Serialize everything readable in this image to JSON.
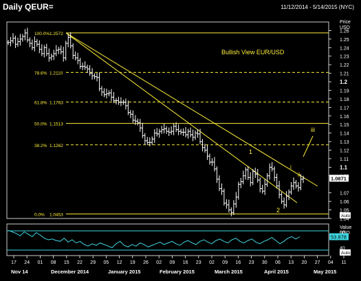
{
  "header": {
    "title": "Daily QEUR=",
    "date_range": "11/12/2014 - 5/14/2015 (NYC)"
  },
  "chart_data": [
    {
      "type": "candlestick",
      "instrument": "QEUR=",
      "title": "Bullish View EUR/USD",
      "y_axis_title": "Price",
      "y_axis_unit": "USD",
      "ylim": [
        1.04,
        1.27
      ],
      "yticks": [
        "1.26",
        "1.25",
        "1.24",
        "1.23",
        "1.22",
        "1.21",
        "1.2",
        "1.19",
        "1.18",
        "1.17",
        "1.16",
        "1.15",
        "1.14",
        "1.13",
        "1.12",
        "1.11",
        "1.1",
        "1.09",
        "1.07",
        "1.06",
        "1.05",
        "1.04"
      ],
      "last_price": "1.0871",
      "date_ticks": [
        "17",
        "24",
        "01",
        "08",
        "15",
        "22",
        "29",
        "05",
        "12",
        "19",
        "26",
        "02",
        "09",
        "16",
        "23",
        "02",
        "09",
        "16",
        "23",
        "30",
        "06",
        "13",
        "20",
        "27",
        "04",
        "11"
      ],
      "month_labels": [
        "Nov 14",
        "December 2014",
        "January 2015",
        "February 2015",
        "March 2015",
        "April 2015",
        "May 2015"
      ],
      "fibonacci_levels": [
        {
          "pct": "100.0%",
          "value": "1.2572",
          "style": "solid"
        },
        {
          "pct": "78.6%",
          "value": "1.2110",
          "style": "dashed"
        },
        {
          "pct": "61.8%",
          "value": "1.1763",
          "style": "dashed"
        },
        {
          "pct": "50.0%",
          "value": "1.1513",
          "style": "solid"
        },
        {
          "pct": "38.2%",
          "value": "1.1262",
          "style": "dashed"
        },
        {
          "pct": "0.0%",
          "value": "1.0453",
          "style": "solid"
        }
      ],
      "wave_labels": [
        "1",
        "2",
        "i",
        "ii",
        "iii"
      ],
      "closes": [
        1.246,
        1.248,
        1.251,
        1.244,
        1.247,
        1.25,
        1.253,
        1.2572,
        1.249,
        1.245,
        1.24,
        1.247,
        1.244,
        1.238,
        1.233,
        1.24,
        1.233,
        1.228,
        1.23,
        1.233,
        1.237,
        1.238,
        1.235,
        1.228,
        1.245,
        1.252,
        1.242,
        1.231,
        1.228,
        1.225,
        1.218,
        1.218,
        1.217,
        1.215,
        1.21,
        1.207,
        1.206,
        1.205,
        1.192,
        1.188,
        1.185,
        1.186,
        1.187,
        1.182,
        1.178,
        1.178,
        1.176,
        1.176,
        1.176,
        1.172,
        1.164,
        1.162,
        1.155,
        1.154,
        1.152,
        1.146,
        1.137,
        1.131,
        1.129,
        1.129,
        1.133,
        1.14,
        1.139,
        1.142,
        1.144,
        1.145,
        1.142,
        1.141,
        1.142,
        1.148,
        1.144,
        1.142,
        1.141,
        1.141,
        1.138,
        1.142,
        1.138,
        1.135,
        1.14,
        1.139,
        1.13,
        1.123,
        1.12,
        1.113,
        1.106,
        1.106,
        1.098,
        1.086,
        1.075,
        1.072,
        1.058,
        1.056,
        1.05,
        1.047,
        1.057,
        1.065,
        1.08,
        1.083,
        1.09,
        1.097,
        1.088,
        1.082,
        1.095,
        1.092,
        1.085,
        1.075,
        1.072,
        1.08,
        1.09,
        1.1,
        1.098,
        1.088,
        1.078,
        1.068,
        1.06,
        1.056,
        1.066,
        1.071,
        1.078,
        1.082,
        1.078,
        1.076,
        1.086,
        1.0871
      ]
    },
    {
      "type": "line",
      "title": "Value",
      "unit": "USD",
      "yticks": [
        "60",
        "40"
      ],
      "last_value": "53.878",
      "series": [
        {
          "values": [
            62,
            60,
            58,
            55,
            60,
            57,
            54,
            59,
            56,
            52,
            50,
            51,
            49,
            48,
            52,
            47,
            50,
            46,
            48,
            44,
            42,
            45,
            43,
            46,
            44,
            42,
            40,
            45,
            48,
            43,
            41,
            44,
            42,
            46,
            44,
            41,
            43,
            45,
            47,
            44,
            46,
            48,
            45,
            43,
            47,
            49,
            46,
            44,
            48,
            50,
            47,
            45,
            49,
            51,
            48,
            46,
            50,
            52,
            48,
            46,
            49,
            51,
            47,
            45,
            48,
            50,
            53,
            49,
            45,
            48,
            52,
            54,
            51,
            53.878
          ]
        }
      ]
    }
  ],
  "footer": {
    "auto_label": "Auto"
  }
}
